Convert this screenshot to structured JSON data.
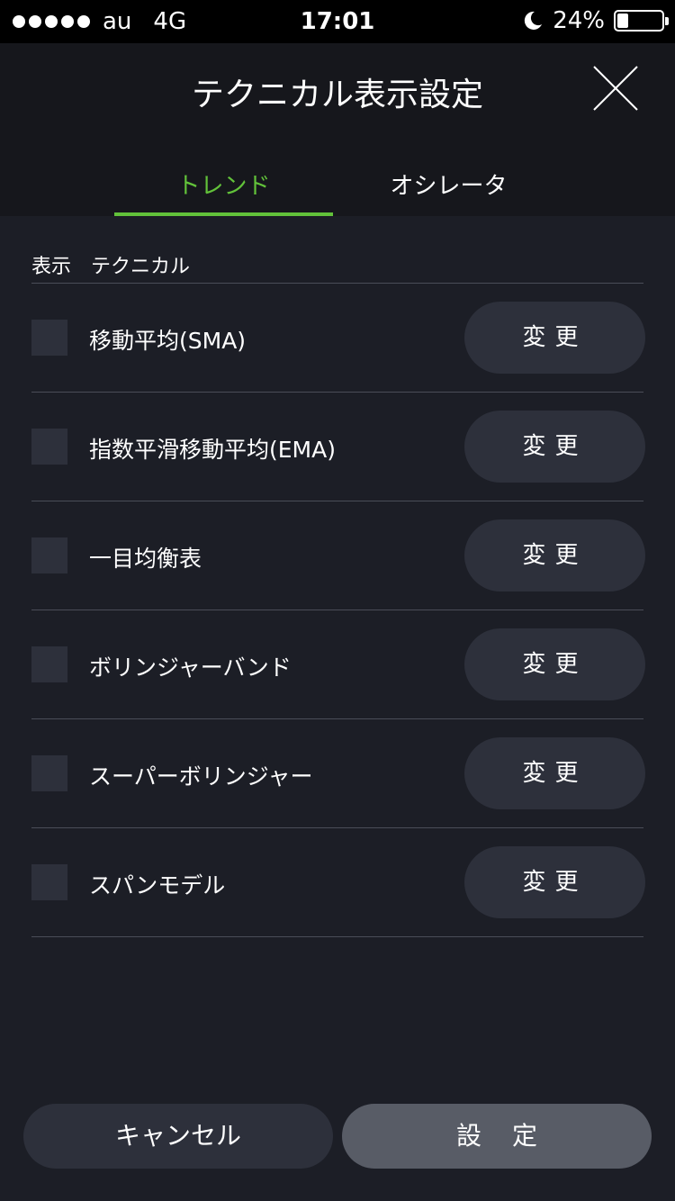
{
  "status": {
    "carrier": "au",
    "network": "4G",
    "time": "17:01",
    "battery_percent": "24%",
    "battery_level": 0.24,
    "moon_icon": "moon-icon"
  },
  "header": {
    "title": "テクニカル表示設定",
    "close_icon": "close-icon"
  },
  "tabs": [
    {
      "label": "トレンド",
      "active": true
    },
    {
      "label": "オシレータ",
      "active": false
    }
  ],
  "list_header": {
    "col_display": "表示",
    "col_technical": "テクニカル"
  },
  "items": [
    {
      "label": "移動平均(SMA)",
      "button": "変更",
      "checked": false
    },
    {
      "label": "指数平滑移動平均(EMA)",
      "button": "変更",
      "checked": false
    },
    {
      "label": "一目均衡表",
      "button": "変更",
      "checked": false
    },
    {
      "label": "ボリンジャーバンド",
      "button": "変更",
      "checked": false
    },
    {
      "label": "スーパーボリンジャー",
      "button": "変更",
      "checked": false
    },
    {
      "label": "スパンモデル",
      "button": "変更",
      "checked": false
    }
  ],
  "footer": {
    "cancel_label": "キャンセル",
    "ok_label": "設定"
  },
  "colors": {
    "accent": "#62c23a",
    "background": "#1c1e26",
    "header_bg": "#16171c",
    "button_bg": "#2d303b",
    "ok_bg": "#585c66"
  }
}
